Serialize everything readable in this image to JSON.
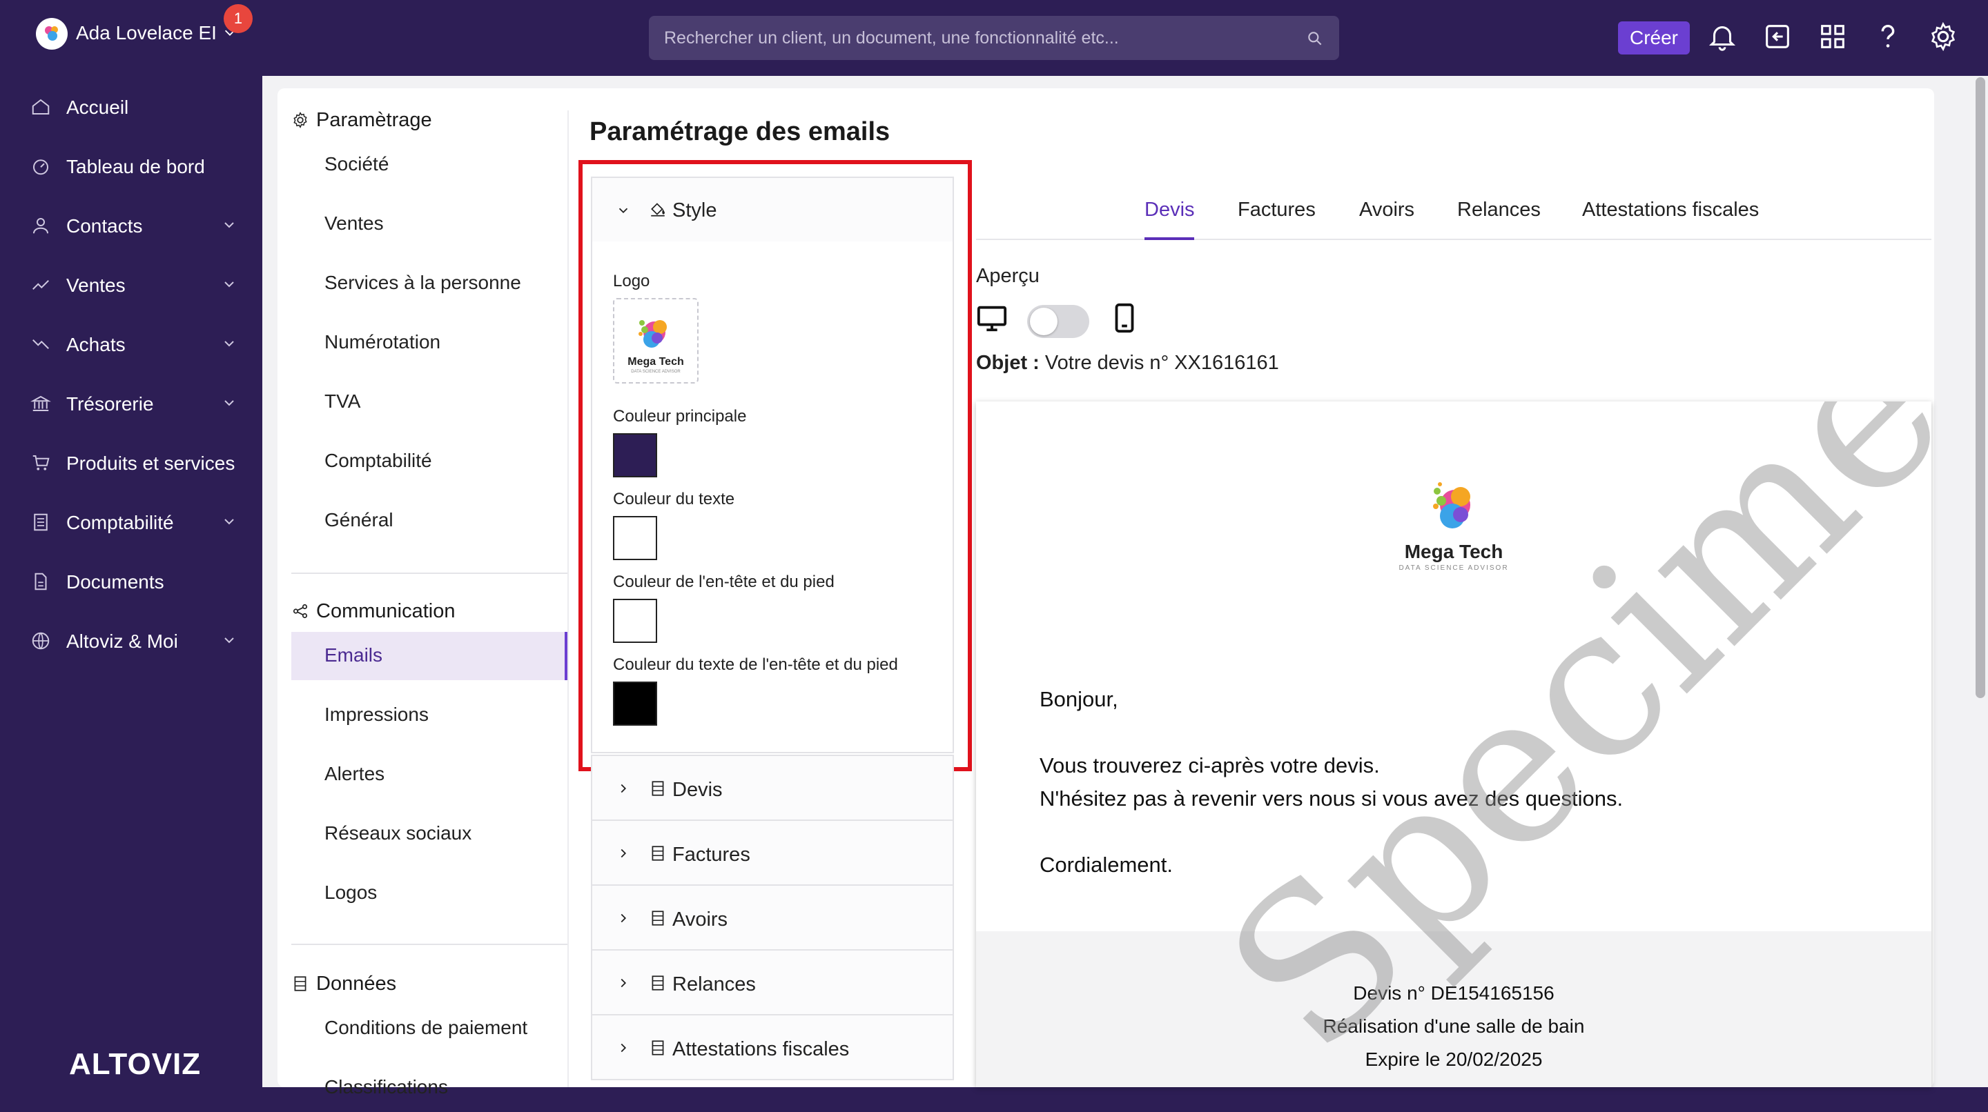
{
  "user": {
    "name": "Ada Lovelace EI",
    "notification_count": "1"
  },
  "search": {
    "placeholder": "Rechercher un client, un document, une fonctionnalité etc..."
  },
  "topbar": {
    "create_label": "Créer"
  },
  "sidebar": {
    "items": [
      {
        "label": "Accueil",
        "icon": "home-icon",
        "has_chevron": false
      },
      {
        "label": "Tableau de bord",
        "icon": "dashboard-icon",
        "has_chevron": false
      },
      {
        "label": "Contacts",
        "icon": "user-icon",
        "has_chevron": true
      },
      {
        "label": "Ventes",
        "icon": "trend-up-icon",
        "has_chevron": true
      },
      {
        "label": "Achats",
        "icon": "trend-down-icon",
        "has_chevron": true
      },
      {
        "label": "Trésorerie",
        "icon": "bank-icon",
        "has_chevron": true
      },
      {
        "label": "Produits et services",
        "icon": "cart-icon",
        "has_chevron": false
      },
      {
        "label": "Comptabilité",
        "icon": "ledger-icon",
        "has_chevron": true
      },
      {
        "label": "Documents",
        "icon": "document-icon",
        "has_chevron": false
      },
      {
        "label": "Altoviz & Moi",
        "icon": "globe-icon",
        "has_chevron": true
      }
    ],
    "brand": "ALTOVIZ"
  },
  "settings_nav": {
    "parametrage": {
      "title": "Paramètrage",
      "items": [
        "Société",
        "Ventes",
        "Services à la personne",
        "Numérotation",
        "TVA",
        "Comptabilité",
        "Général"
      ]
    },
    "communication": {
      "title": "Communication",
      "items": [
        "Emails",
        "Impressions",
        "Alertes",
        "Réseaux sociaux",
        "Logos"
      ],
      "active": "Emails"
    },
    "donnees": {
      "title": "Données",
      "items": [
        "Conditions de paiement",
        "Classifications"
      ]
    }
  },
  "page": {
    "title": "Paramétrage des emails"
  },
  "style_panel": {
    "title": "Style",
    "logo_label": "Logo",
    "colors": [
      {
        "label": "Couleur principale",
        "value": "#2d1e55"
      },
      {
        "label": "Couleur du texte",
        "value": "#ffffff"
      },
      {
        "label": "Couleur de l'en-tête et du pied",
        "value": "#ffffff"
      },
      {
        "label": "Couleur du texte de l'en-tête et du pied",
        "value": "#000000"
      }
    ]
  },
  "accordions": [
    "Devis",
    "Factures",
    "Avoirs",
    "Relances",
    "Attestations fiscales"
  ],
  "tabs": {
    "items": [
      "Devis",
      "Factures",
      "Avoirs",
      "Relances",
      "Attestations fiscales"
    ],
    "active": "Devis"
  },
  "preview": {
    "label": "Aperçu",
    "subject_label": "Objet :",
    "subject_value": "Votre devis n° XX1616161",
    "company_name": "Mega Tech",
    "company_tagline": "DATA SCIENCE ADVISOR",
    "greeting": "Bonjour,",
    "line1": "Vous trouverez ci-après votre devis.",
    "line2": "N'hésitez pas à revenir vers nous si vous avez des questions.",
    "closing": "Cordialement.",
    "footer_line1": "Devis n° DE154165156",
    "footer_line2": "Réalisation d'une salle de bain",
    "footer_line3": "Expire le 20/02/2025",
    "watermark": "Specimen"
  },
  "logo_thumb": {
    "name": "Mega Tech",
    "tagline": "DATA SCIENCE ADVISOR"
  }
}
